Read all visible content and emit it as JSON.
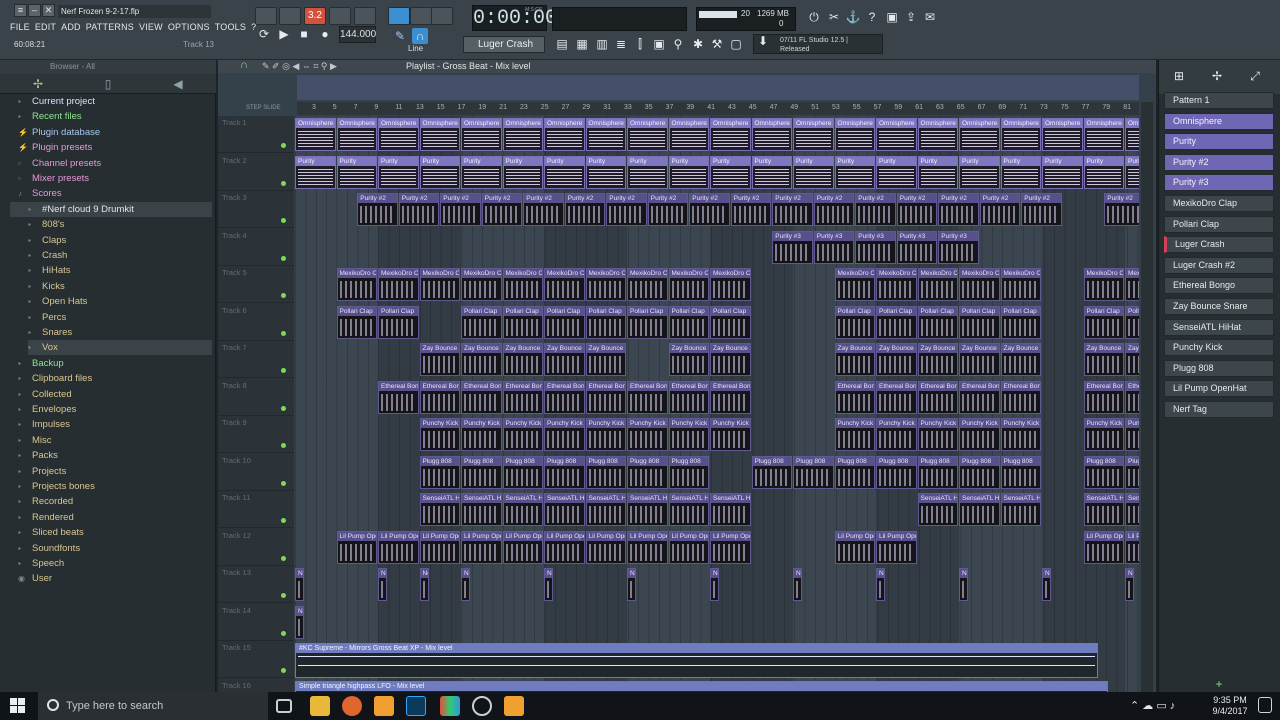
{
  "window": {
    "title": "Nerf Frozen 9-2-17.flp",
    "hint_time": "60:08:21",
    "hint_right": "Track 13"
  },
  "menu": [
    "FILE",
    "EDIT",
    "ADD",
    "PATTERNS",
    "VIEW",
    "OPTIONS",
    "TOOLS",
    "?"
  ],
  "transport": {
    "time": "0:00:00",
    "time_unit": "M:S:CS",
    "tempo": "144.000",
    "pattern_pos": "3.2",
    "snap": "Line",
    "pattern_selected": "Luger Crash",
    "memory": "1269 MB",
    "voices": "20",
    "cpu": "0"
  },
  "news": {
    "line1": "07/11  FL Studio 12.5 |",
    "line2": "Released"
  },
  "browser": {
    "header": "Browser - All",
    "items": [
      {
        "label": "Current project",
        "color": "#d8e3ff",
        "icon": "folder-icon"
      },
      {
        "label": "Recent files",
        "color": "#8fe38f",
        "icon": "folder-icon"
      },
      {
        "label": "Plugin database",
        "color": "#a8c6f0",
        "icon": "plug-icon"
      },
      {
        "label": "Plugin presets",
        "color": "#e79ad8",
        "icon": "plug-icon"
      },
      {
        "label": "Channel presets",
        "color": "#e79ad8",
        "icon": "preset-icon"
      },
      {
        "label": "Mixer presets",
        "color": "#e79ad8",
        "icon": "preset-icon"
      },
      {
        "label": "Scores",
        "color": "#e79ad8",
        "icon": "score-icon"
      },
      {
        "label": "#Nerf cloud 9 Drumkit",
        "color": "#dfe6ea",
        "icon": "folder-icon",
        "selected": true
      },
      {
        "label": "808's",
        "color": "#d9c690",
        "icon": "folder-icon",
        "sub": true
      },
      {
        "label": "Claps",
        "color": "#d9c690",
        "icon": "folder-icon",
        "sub": true
      },
      {
        "label": "Crash",
        "color": "#d9c690",
        "icon": "folder-icon",
        "sub": true
      },
      {
        "label": "HiHats",
        "color": "#d9c690",
        "icon": "folder-icon",
        "sub": true
      },
      {
        "label": "Kicks",
        "color": "#d9c690",
        "icon": "folder-icon",
        "sub": true
      },
      {
        "label": "Open Hats",
        "color": "#d9c690",
        "icon": "folder-icon",
        "sub": true
      },
      {
        "label": "Percs",
        "color": "#d9c690",
        "icon": "folder-icon",
        "sub": true
      },
      {
        "label": "Snares",
        "color": "#d9c690",
        "icon": "folder-icon",
        "sub": true
      },
      {
        "label": "Vox",
        "color": "#d9c690",
        "icon": "folder-icon",
        "sub": true,
        "selected": true
      },
      {
        "label": "Backup",
        "color": "#8fe38f",
        "icon": "folder-icon"
      },
      {
        "label": "Clipboard files",
        "color": "#d9c690",
        "icon": "folder-icon"
      },
      {
        "label": "Collected",
        "color": "#d9c690",
        "icon": "folder-icon"
      },
      {
        "label": "Envelopes",
        "color": "#d9c690",
        "icon": "folder-icon"
      },
      {
        "label": "Impulses",
        "color": "#d9c690",
        "icon": "folder-icon"
      },
      {
        "label": "Misc",
        "color": "#d9c690",
        "icon": "folder-icon"
      },
      {
        "label": "Packs",
        "color": "#d9c690",
        "icon": "folder-icon"
      },
      {
        "label": "Projects",
        "color": "#d9c690",
        "icon": "folder-icon"
      },
      {
        "label": "Projects bones",
        "color": "#d9c690",
        "icon": "folder-icon"
      },
      {
        "label": "Recorded",
        "color": "#d9c690",
        "icon": "folder-icon"
      },
      {
        "label": "Rendered",
        "color": "#d9c690",
        "icon": "folder-icon"
      },
      {
        "label": "Sliced beats",
        "color": "#d9c690",
        "icon": "folder-icon"
      },
      {
        "label": "Soundfonts",
        "color": "#d9c690",
        "icon": "folder-icon"
      },
      {
        "label": "Speech",
        "color": "#d9c690",
        "icon": "folder-icon"
      },
      {
        "label": "User",
        "color": "#d9c690",
        "icon": "user-icon"
      }
    ]
  },
  "playlist": {
    "title": "Playlist - Gross Beat - Mix level",
    "ruler": [
      "3",
      "5",
      "7",
      "9",
      "11",
      "13",
      "15",
      "17",
      "19",
      "21",
      "23",
      "25",
      "27",
      "29",
      "31",
      "33",
      "35",
      "37",
      "39",
      "41",
      "43",
      "45",
      "47",
      "49",
      "51",
      "53",
      "55",
      "57",
      "59",
      "61",
      "63",
      "65",
      "67",
      "69",
      "71",
      "73",
      "75",
      "77",
      "79",
      "81"
    ],
    "tracks": [
      "Track 1",
      "Track 2",
      "Track 3",
      "Track 4",
      "Track 5",
      "Track 6",
      "Track 7",
      "Track 8",
      "Track 9",
      "Track 10",
      "Track 11",
      "Track 12",
      "Track 13",
      "Track 14",
      "Track 15",
      "Track 16"
    ],
    "automation": [
      {
        "label": "#KC Supreme - Mirrors Gross Beat XP - Mix level"
      },
      {
        "label": "Simple triangle highpass LFO - Mix level"
      }
    ]
  },
  "picker": {
    "items": [
      {
        "label": "Pattern 1",
        "hl": false
      },
      {
        "label": "Omnisphere",
        "hl": true
      },
      {
        "label": "Purity",
        "hl": true
      },
      {
        "label": "Purity #2",
        "hl": true
      },
      {
        "label": "Purity #3",
        "hl": true
      },
      {
        "label": "MexikoDro Clap",
        "hl": false
      },
      {
        "label": "Pollari Clap",
        "hl": false
      },
      {
        "label": "Luger Crash",
        "hl": false,
        "crash": true
      },
      {
        "label": "Luger Crash #2",
        "hl": false
      },
      {
        "label": "Ethereal Bongo",
        "hl": false
      },
      {
        "label": "Zay Bounce Snare",
        "hl": false
      },
      {
        "label": "SenseiATL HiHat",
        "hl": false
      },
      {
        "label": "Punchy Kick",
        "hl": false
      },
      {
        "label": "Plugg 808",
        "hl": false
      },
      {
        "label": "Lil Pump OpenHat",
        "hl": false
      },
      {
        "label": "Nerf Tag",
        "hl": false
      }
    ]
  },
  "taskbar": {
    "search_placeholder": "Type here to search",
    "time": "9:35 PM",
    "date": "9/4/2017"
  }
}
